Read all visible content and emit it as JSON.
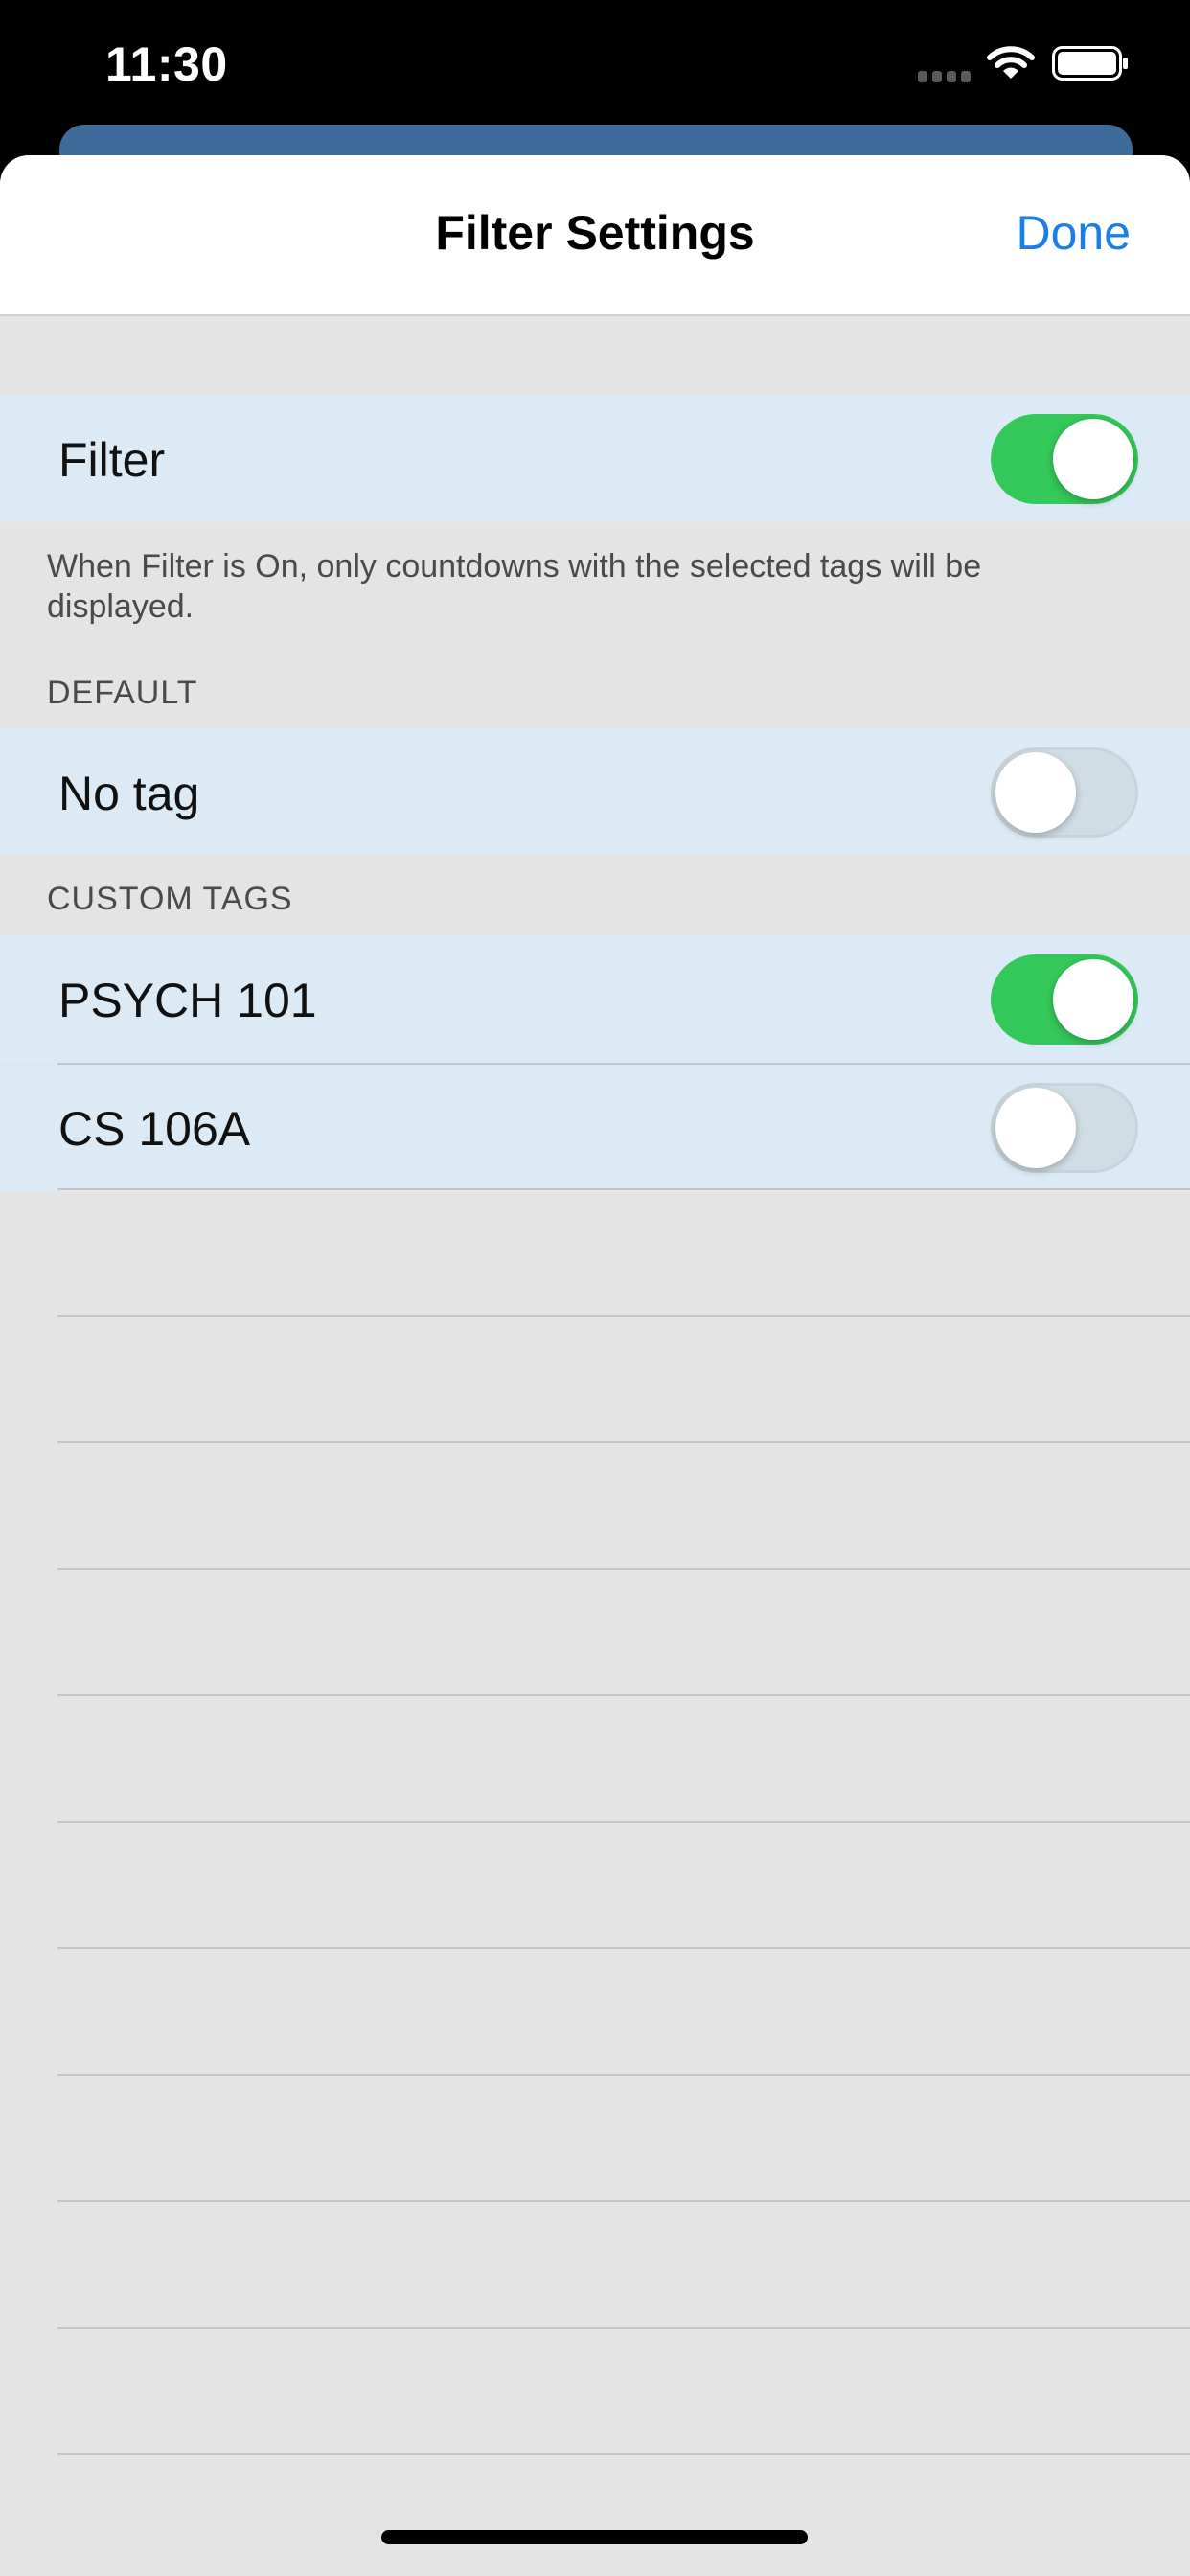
{
  "status_bar": {
    "time": "11:30",
    "icons": [
      "signal-icon",
      "wifi-icon",
      "battery-icon"
    ]
  },
  "nav": {
    "title": "Filter Settings",
    "done_label": "Done"
  },
  "filter": {
    "label": "Filter",
    "enabled": true,
    "footer": "When Filter is On, only countdowns with the selected tags will be displayed."
  },
  "default_section": {
    "header": "DEFAULT",
    "items": [
      {
        "label": "No tag",
        "enabled": false
      }
    ]
  },
  "custom_section": {
    "header": "CUSTOM TAGS",
    "items": [
      {
        "label": "PSYCH 101",
        "enabled": true
      },
      {
        "label": "CS 106A",
        "enabled": false
      }
    ]
  },
  "colors": {
    "accent": "#1a7ee6",
    "toggle_on": "#34c759",
    "row_background": "#dbeaf4",
    "background": "#e4e4e4"
  }
}
